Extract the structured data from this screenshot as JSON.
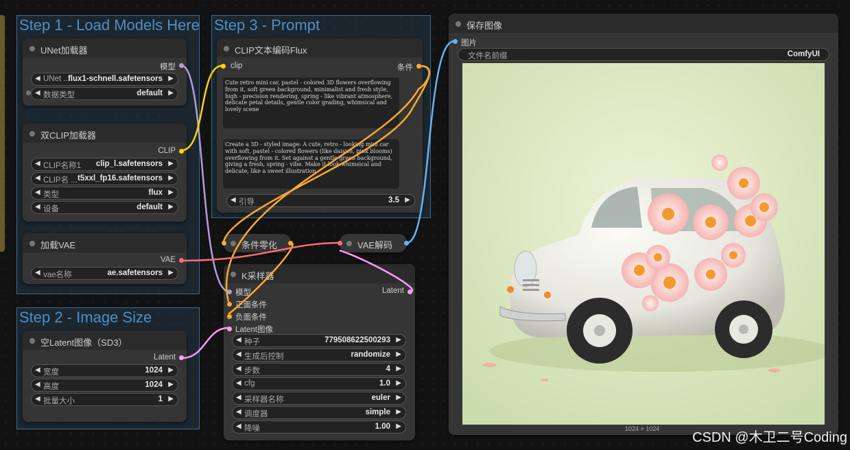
{
  "groups": {
    "step1": "Step 1 - Load Models Here",
    "step2": "Step 2 - Image Size",
    "step3": "Step 3 - Prompt"
  },
  "unet_loader": {
    "title": "UNet加载器",
    "output": "模型",
    "widgets": [
      {
        "label": "UNet ...",
        "value": "flux1-schnell.safetensors"
      },
      {
        "label": "数据类型",
        "value": "default"
      }
    ]
  },
  "dual_clip": {
    "title": "双CLIP加载器",
    "output": "CLIP",
    "widgets": [
      {
        "label": "CLIP名称1",
        "value": "clip_l.safetensors"
      },
      {
        "label": "CLIP名 ...",
        "value": "t5xxl_fp16.safetensors"
      },
      {
        "label": "类型",
        "value": "flux"
      },
      {
        "label": "设备",
        "value": "default"
      }
    ]
  },
  "vae_loader": {
    "title": "加载VAE",
    "output": "VAE",
    "widgets": [
      {
        "label": "vae名称",
        "value": "ae.safetensors"
      }
    ]
  },
  "empty_latent": {
    "title": "空Latent图像（SD3）",
    "output": "Latent",
    "widgets": [
      {
        "label": "宽度",
        "value": "1024"
      },
      {
        "label": "高度",
        "value": "1024"
      },
      {
        "label": "批量大小",
        "value": "1"
      }
    ]
  },
  "clip_encode": {
    "title": "CLIP文本编码Flux",
    "input": "clip",
    "output": "条件",
    "text1": "Cute retro mini car, pastel - colored 3D flowers overflowing from it, soft green background, minimalist and fresh style, high - precision rendering, spring - like vibrant atmosphere, delicate petal details, gentle color grading, whimsical and lovely scene",
    "text2": "Create a 3D - styled image: A cute, retro - looking mini car with soft, pastel - colored flowers (like daisies, pink blooms) overflowing from it. Set against a gentle green background, giving a fresh, spring - vibe. Make it look whimsical and delicate, like a sweet illustration.",
    "guidance_label": "引导",
    "guidance_value": "3.5"
  },
  "cond_zero": {
    "title": "条件零化"
  },
  "vae_decode": {
    "title": "VAE解码"
  },
  "ksampler": {
    "title": "K采样器",
    "inputs": [
      "模型",
      "正面条件",
      "负面条件",
      "Latent图像"
    ],
    "output": "Latent",
    "widgets": [
      {
        "label": "种子",
        "value": "779508622500293"
      },
      {
        "label": "生成后控制",
        "value": "randomize"
      },
      {
        "label": "步数",
        "value": "4"
      },
      {
        "label": "cfg",
        "value": "1.0"
      },
      {
        "label": "采样器名称",
        "value": "euler"
      },
      {
        "label": "调度器",
        "value": "simple"
      },
      {
        "label": "降噪",
        "value": "1.00"
      }
    ]
  },
  "save_image": {
    "title": "保存图像",
    "input": "图片",
    "prefix_label": "文件名前缀",
    "prefix_value": "ComfyUI",
    "image_size": "1024 × 1024"
  },
  "watermark": "CSDN @木卫二号Coding",
  "colors": {
    "model": "#b39ddb",
    "clip": "#ffd500",
    "conditioning": "#ffa931",
    "vae": "#ff6e6e",
    "latent": "#ff9cf9",
    "image": "#64b5f6"
  }
}
